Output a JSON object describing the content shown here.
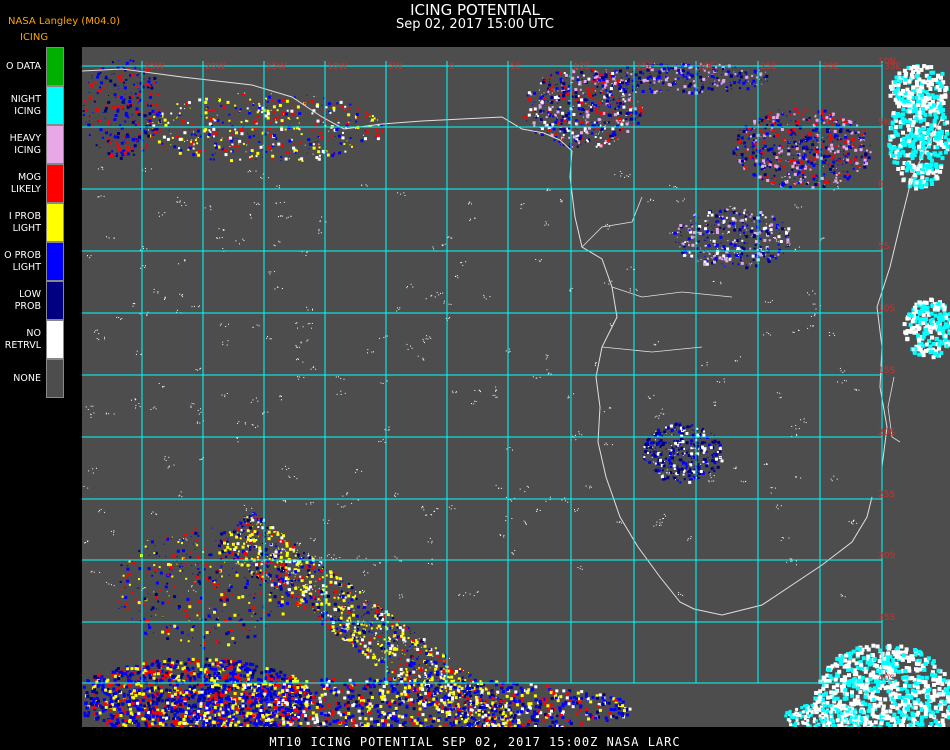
{
  "header": {
    "title": "ICING POTENTIAL",
    "subtitle": "Sep 02, 2017 15:00 UTC",
    "org": "NASA Langley (M04.0)",
    "legend_title": "ICING"
  },
  "legend": [
    {
      "label": "O DATA",
      "color": "#00b000"
    },
    {
      "label": "NIGHT\nICING",
      "color": "#00ffff"
    },
    {
      "label": "HEAVY\nICING",
      "color": "#e8a8e8"
    },
    {
      "label": "MOG\nLIKELY",
      "color": "#ff0000"
    },
    {
      "label": "I PROB\nLIGHT",
      "color": "#ffff00"
    },
    {
      "label": "O PROB\nLIGHT",
      "color": "#0000ff"
    },
    {
      "label": "LOW\nPROB",
      "color": "#000080"
    },
    {
      "label": "NO\nRETRVL",
      "color": "#ffffff"
    },
    {
      "label": "NONE",
      "color": "#4d4d4d"
    }
  ],
  "grid": {
    "lon_labels": [
      "25W",
      "20W",
      "15W",
      "10W",
      "5W",
      "0",
      "5E",
      "10E",
      "15E",
      "20E",
      "25E",
      "30E",
      "35E"
    ],
    "lat_labels": [
      "10N",
      "5N",
      "0",
      "5S",
      "10S",
      "15S",
      "20S",
      "25S",
      "30S",
      "35S",
      "40S"
    ]
  },
  "colors": {
    "background": "#000000",
    "map_bg": "#4d4d4d",
    "grid": "#00ffff",
    "grid_label": "#c83232",
    "coast": "#e0e0e0",
    "title": "#ffffff",
    "org": "#ffa500"
  },
  "footer": "MT10  ICING POTENTIAL   SEP 02, 2017 15:00Z   NASA LARC"
}
